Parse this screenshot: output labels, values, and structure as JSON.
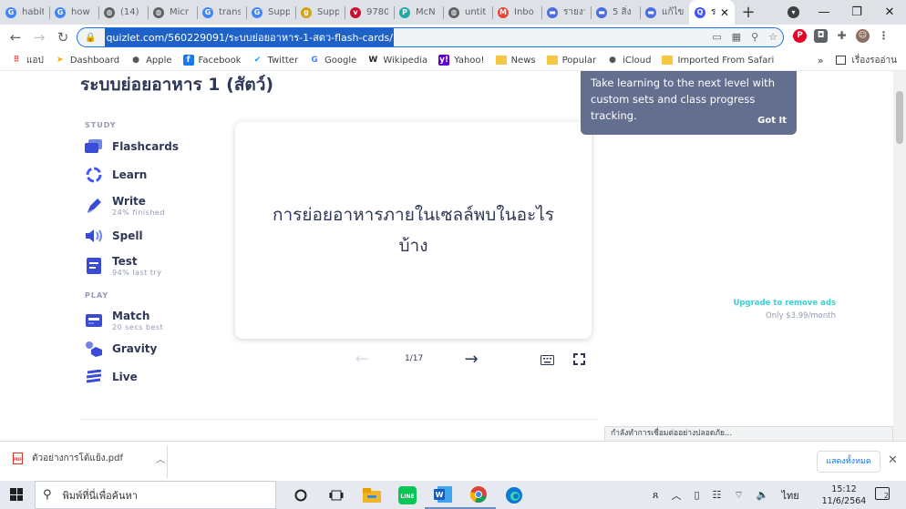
{
  "browser": {
    "tabs": [
      {
        "title": "habit",
        "favicon": "G",
        "color": "#4285f4"
      },
      {
        "title": "how",
        "favicon": "G",
        "color": "#4285f4"
      },
      {
        "title": "(14) (",
        "favicon": "globe",
        "color": "#5f6368"
      },
      {
        "title": "Micr",
        "favicon": "globe",
        "color": "#5f6368"
      },
      {
        "title": "trans",
        "favicon": "G",
        "color": "#4285f4"
      },
      {
        "title": "Supp",
        "favicon": "G",
        "color": "#4285f4"
      },
      {
        "title": "Supp",
        "favicon": "g",
        "color": "#d4a017"
      },
      {
        "title": "9780",
        "favicon": "v",
        "color": "#c8102e"
      },
      {
        "title": "McN",
        "favicon": "P",
        "color": "#1fa8a8"
      },
      {
        "title": "untit",
        "favicon": "globe",
        "color": "#5f6368"
      },
      {
        "title": "Inbo",
        "favicon": "M",
        "color": "#ea4335"
      },
      {
        "title": "รายงา",
        "favicon": "bar",
        "color": "#4a6ee0"
      },
      {
        "title": "5 สิ่ง",
        "favicon": "bar",
        "color": "#4a6ee0"
      },
      {
        "title": "แก้ไข",
        "favicon": "bar",
        "color": "#4a6ee0"
      },
      {
        "title": "ระ",
        "favicon": "Q",
        "color": "#4255ff",
        "active": true
      }
    ],
    "new_tab": "+",
    "window_controls": {
      "minimize": "—",
      "restore": "❐",
      "close": "✕"
    },
    "url": "quizlet.com/560229091/ระบบย่อยอาหาร-1-สตว-flash-cards/",
    "bookmarks": [
      {
        "label": "แอป",
        "icon": "apps-grid"
      },
      {
        "label": "Dashboard",
        "icon": "dashboard-icon"
      },
      {
        "label": "Apple",
        "icon": "apple-icon"
      },
      {
        "label": "Facebook",
        "icon": "facebook-icon"
      },
      {
        "label": "Twitter",
        "icon": "twitter-icon"
      },
      {
        "label": "Google",
        "icon": "google-icon"
      },
      {
        "label": "Wikipedia",
        "icon": "wikipedia-icon"
      },
      {
        "label": "Yahoo!",
        "icon": "yahoo-icon"
      },
      {
        "label": "News",
        "icon": "folder-icon"
      },
      {
        "label": "Popular",
        "icon": "folder-icon"
      },
      {
        "label": "iCloud",
        "icon": "apple-icon"
      },
      {
        "label": "Imported From Safari",
        "icon": "folder-icon"
      }
    ],
    "bookmarks_more": "»",
    "reading_list": "เรื่องรออ่าน"
  },
  "page": {
    "set_title": "ระบบย่อยอาหาร 1 (สัตว์)",
    "study_label": "STUDY",
    "play_label": "PLAY",
    "study_modes": [
      {
        "label": "Flashcards",
        "sub": ""
      },
      {
        "label": "Learn",
        "sub": ""
      },
      {
        "label": "Write",
        "sub": "24% finished"
      },
      {
        "label": "Spell",
        "sub": ""
      },
      {
        "label": "Test",
        "sub": "94% last try"
      }
    ],
    "play_modes": [
      {
        "label": "Match",
        "sub": "20 secs best"
      },
      {
        "label": "Gravity",
        "sub": ""
      },
      {
        "label": "Live",
        "sub": ""
      }
    ],
    "card_term": "การย่อยอาหารภายในเซลล์พบในอะไรบ้าง",
    "counter": "1/17",
    "promo": {
      "text": "Take learning to the next level with custom sets and class progress tracking.",
      "got_it": "Got It"
    },
    "ad": {
      "upgrade": "Upgrade to remove ads",
      "price": "Only $3.99/month"
    },
    "status": "กำลังทำการเชื่อมต่ออย่างปลอดภัย..."
  },
  "downloads": {
    "file": "ตัวอย่างการโต้แย้ง.pdf",
    "show_all": "แสดงทั้งหมด"
  },
  "taskbar": {
    "search_placeholder": "พิมพ์ที่นี่เพื่อค้นหา",
    "language": "ไทย",
    "time": "15:12",
    "date": "11/6/2564",
    "notifications": "2"
  },
  "colors": {
    "quizlet_blue": "#4255ff",
    "text_primary": "#2e3856",
    "text_muted": "#939bb4",
    "promo_bg": "#646f90",
    "ad_teal": "#3ccfcf"
  }
}
